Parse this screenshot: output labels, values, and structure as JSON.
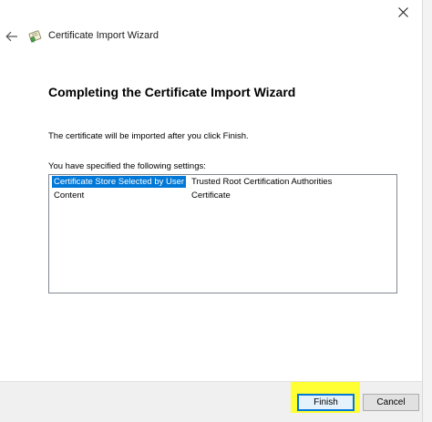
{
  "window": {
    "title": "Certificate Import Wizard",
    "icons": {
      "close": "close-icon",
      "back": "arrow-left-icon",
      "wizard": "certificate-icon"
    }
  },
  "page": {
    "heading": "Completing the Certificate Import Wizard",
    "info_text": "The certificate will be imported after you click Finish.",
    "settings_label": "You have specified the following settings:"
  },
  "settings": [
    {
      "name": "Certificate Store Selected by User",
      "value": "Trusted Root Certification Authorities",
      "selected": true
    },
    {
      "name": "Content",
      "value": "Certificate",
      "selected": false
    }
  ],
  "buttons": {
    "finish": "Finish",
    "cancel": "Cancel"
  },
  "colors": {
    "selection": "#0078d7",
    "highlight": "#ffff33",
    "accent": "#0078d7"
  }
}
